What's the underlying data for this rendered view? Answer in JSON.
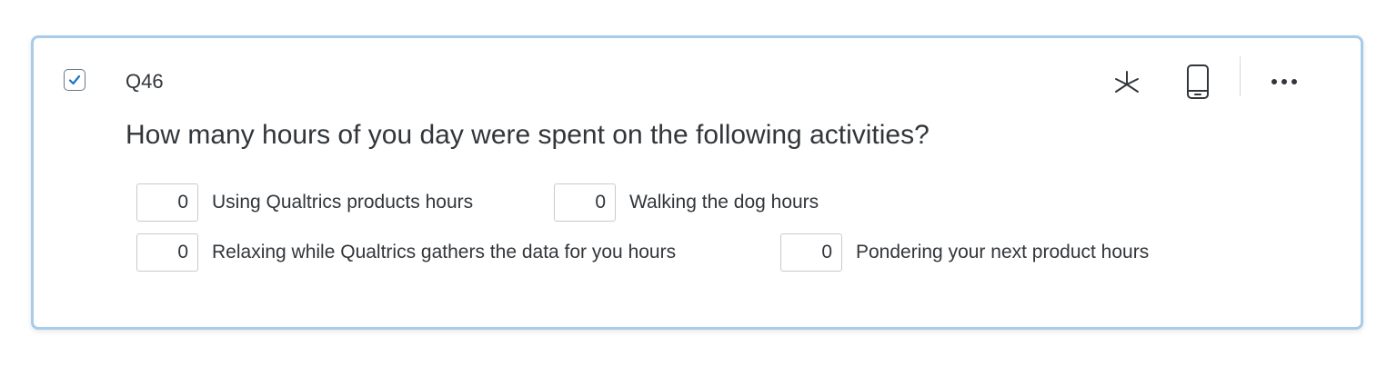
{
  "question": {
    "id_label": "Q46",
    "text": "How many hours of you day were spent on the following activities?",
    "selected": true,
    "choices": [
      {
        "value": "0",
        "label": "Using Qualtrics products hours"
      },
      {
        "value": "0",
        "label": "Walking the dog hours"
      },
      {
        "value": "0",
        "label": "Relaxing while Qualtrics gathers the data for you hours"
      },
      {
        "value": "0",
        "label": "Pondering your next product hours"
      }
    ]
  },
  "toolbar": {
    "icons": [
      "asterisk-icon",
      "mobile-preview-icon",
      "more-options-icon"
    ]
  },
  "colors": {
    "card_border": "#a9cbea",
    "checkbox_check": "#1f72c4",
    "text": "#32363a"
  }
}
